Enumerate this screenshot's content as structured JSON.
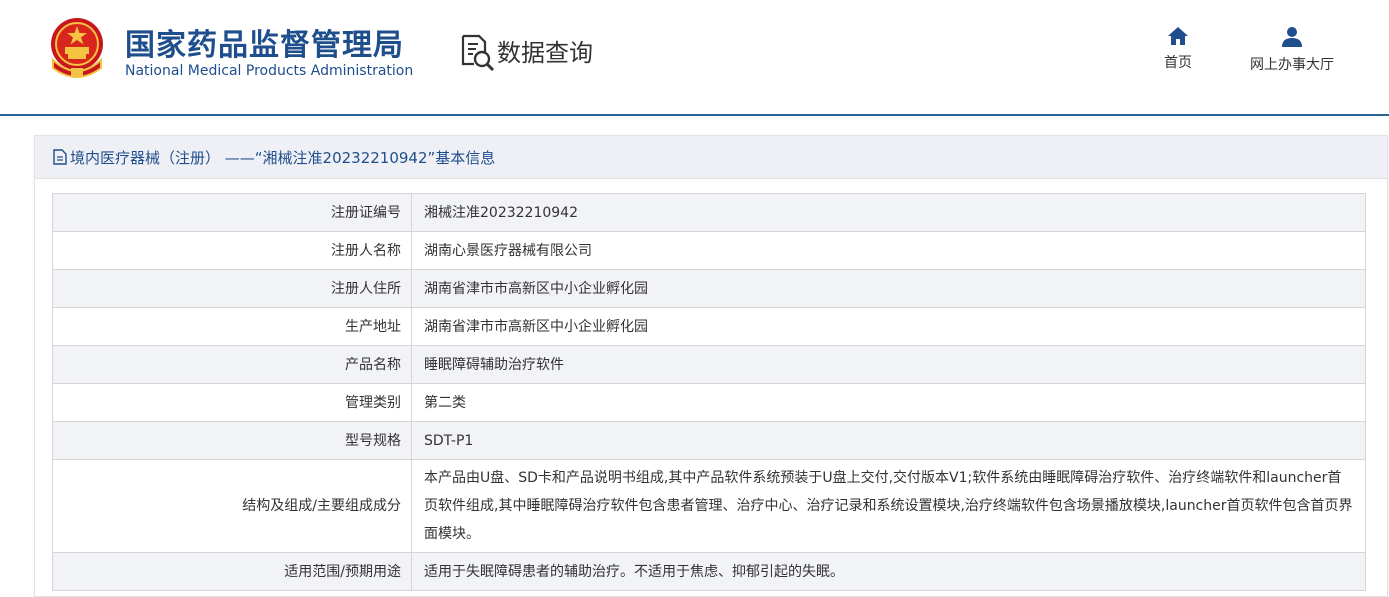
{
  "header": {
    "agency_cn": "国家药品监督管理局",
    "agency_en": "National Medical Products Administration",
    "query_title": "数据查询",
    "nav": [
      {
        "label": "首页",
        "icon": "home-icon"
      },
      {
        "label": "网上办事大厅",
        "icon": "user-icon"
      }
    ]
  },
  "panel": {
    "title": "境内医疗器械（注册） ——“湘械注准20232210942”基本信息",
    "rows": [
      {
        "label": "注册证编号",
        "value": "湘械注准20232210942"
      },
      {
        "label": "注册人名称",
        "value": "湖南心景医疗器械有限公司"
      },
      {
        "label": "注册人住所",
        "value": "湖南省津市市高新区中小企业孵化园"
      },
      {
        "label": "生产地址",
        "value": "湖南省津市市高新区中小企业孵化园"
      },
      {
        "label": "产品名称",
        "value": "睡眠障碍辅助治疗软件"
      },
      {
        "label": "管理类别",
        "value": "第二类"
      },
      {
        "label": "型号规格",
        "value": "SDT-P1"
      },
      {
        "label": "结构及组成/主要组成成分",
        "value": "本产品由U盘、SD卡和产品说明书组成,其中产品软件系统预装于U盘上交付,交付版本V1;软件系统由睡眠障碍治疗软件、治疗终端软件和launcher首页软件组成,其中睡眠障碍治疗软件包含患者管理、治疗中心、治疗记录和系统设置模块,治疗终端软件包含场景播放模块,launcher首页软件包含首页界面模块。"
      },
      {
        "label": "适用范围/预期用途",
        "value": "适用于失眠障碍患者的辅助治疗。不适用于焦虑、抑郁引起的失眠。"
      }
    ]
  },
  "colors": {
    "brand_blue": "#1f4e8c",
    "header_line": "#2a6496",
    "row_alt": "#f2f3f7",
    "title_bar": "#eef0f5"
  }
}
